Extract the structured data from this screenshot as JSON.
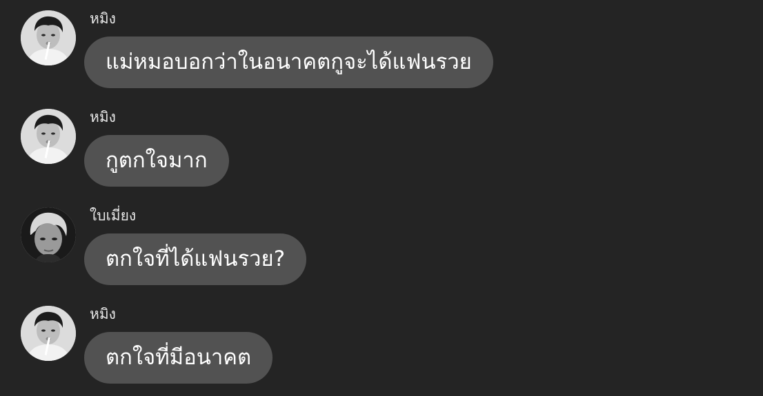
{
  "chat": {
    "messages": [
      {
        "sender": "หมิง",
        "avatar_icon": "avatar-person-straw-icon",
        "text": "แม่หมอบอกว่าในอนาคตกูจะได้แฟนรวย"
      },
      {
        "sender": "หมิง",
        "avatar_icon": "avatar-person-straw-icon",
        "text": "กูตกใจมาก"
      },
      {
        "sender": "ใบเมี่ยง",
        "avatar_icon": "avatar-person-dark-icon",
        "text": "ตกใจที่ได้แฟนรวย?"
      },
      {
        "sender": "หมิง",
        "avatar_icon": "avatar-person-straw-icon",
        "text": "ตกใจที่มีอนาคต"
      }
    ]
  },
  "colors": {
    "background": "#242424",
    "bubble": "#525252",
    "text": "#ffffff",
    "sender_text": "#e6e6e6"
  }
}
